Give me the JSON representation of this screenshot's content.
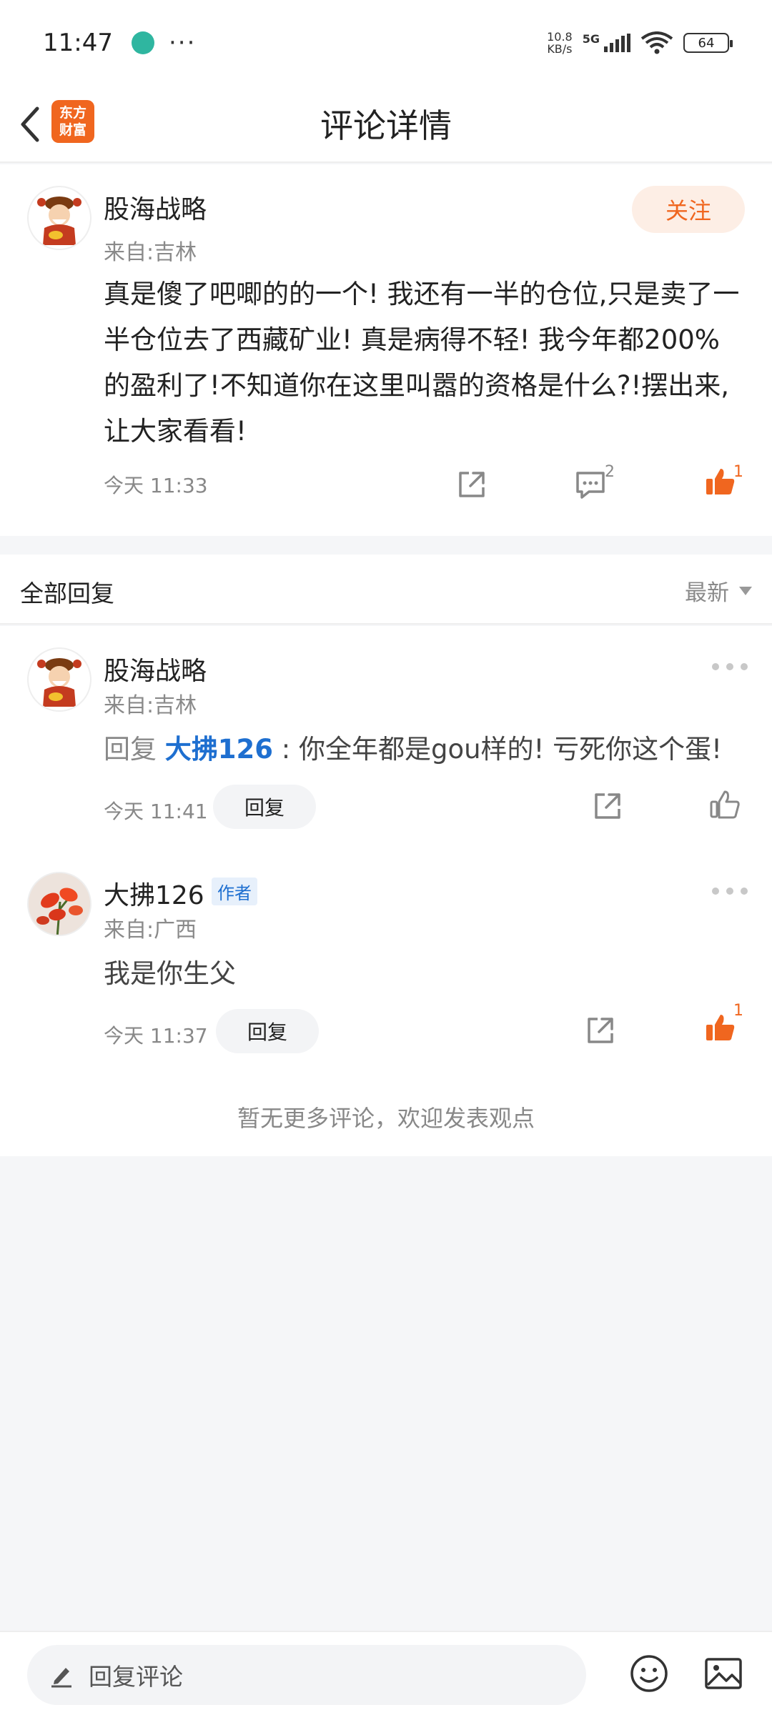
{
  "status_bar": {
    "time": "11:47",
    "dots": "···",
    "speed_value": "10.8",
    "speed_unit": "KB/s",
    "network": "5G",
    "battery": "64"
  },
  "nav": {
    "logo_line1": "东方",
    "logo_line2": "财富",
    "title": "评论详情"
  },
  "main_comment": {
    "username": "股海战略",
    "location": "来自:吉林",
    "follow_label": "关注",
    "text": "真是傻了吧唧的的一个! 我还有一半的仓位,只是卖了一半仓位去了西藏矿业! 真是病得不轻! 我今年都200%的盈利了!不知道你在这里叫嚣的资格是什么?!摆出来,让大家看看!",
    "time": "今天 11:33",
    "comment_count": "2",
    "like_count": "1"
  },
  "replies_header": {
    "title": "全部回复",
    "sort_label": "最新"
  },
  "replies": [
    {
      "username": "股海战略",
      "location": "来自:吉林",
      "reply_prefix": "回复",
      "reply_target": "大拂126",
      "text": " : 你全年都是gou样的! 亏死你这个蛋!",
      "time": "今天 11:41",
      "reply_label": "回复"
    },
    {
      "username": "大拂126",
      "author_tag": "作者",
      "location": "来自:广西",
      "text": "我是你生父",
      "time": "今天 11:37",
      "reply_label": "回复",
      "like_count": "1"
    }
  ],
  "end_note": "暂无更多评论，欢迎发表观点",
  "bottom_bar": {
    "input_placeholder": "回复评论"
  },
  "colors": {
    "accent": "#f0661f",
    "link_blue": "#1e6fd0"
  }
}
